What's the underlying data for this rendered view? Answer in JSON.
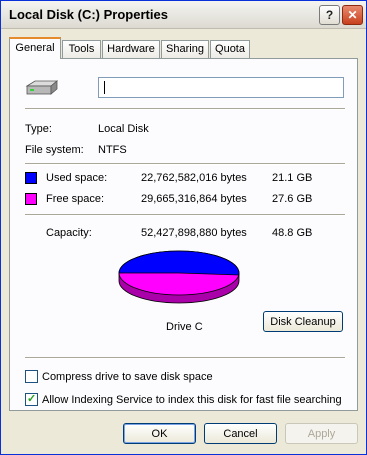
{
  "window": {
    "title": "Local Disk (C:) Properties",
    "help_label": "?",
    "close_label": "✕"
  },
  "tabs": [
    {
      "label": "General",
      "active": true
    },
    {
      "label": "Tools"
    },
    {
      "label": "Hardware"
    },
    {
      "label": "Sharing"
    },
    {
      "label": "Quota"
    }
  ],
  "general": {
    "volume_label_value": "",
    "type_label": "Type:",
    "type_value": "Local Disk",
    "fs_label": "File system:",
    "fs_value": "NTFS",
    "used": {
      "label": "Used space:",
      "bytes": "22,762,582,016 bytes",
      "size": "21.1 GB",
      "color": "#0000ff"
    },
    "free": {
      "label": "Free space:",
      "bytes": "29,665,316,864 bytes",
      "size": "27.6 GB",
      "color": "#ff00ff"
    },
    "capacity": {
      "label": "Capacity:",
      "bytes": "52,427,898,880 bytes",
      "size": "48.8 GB"
    },
    "drive_caption": "Drive C",
    "disk_cleanup_label": "Disk Cleanup",
    "compress_label": "Compress drive to save disk space",
    "compress_checked": false,
    "indexing_label": "Allow Indexing Service to index this disk for fast file searching",
    "indexing_checked": true
  },
  "buttons": {
    "ok": "OK",
    "cancel": "Cancel",
    "apply": "Apply"
  }
}
